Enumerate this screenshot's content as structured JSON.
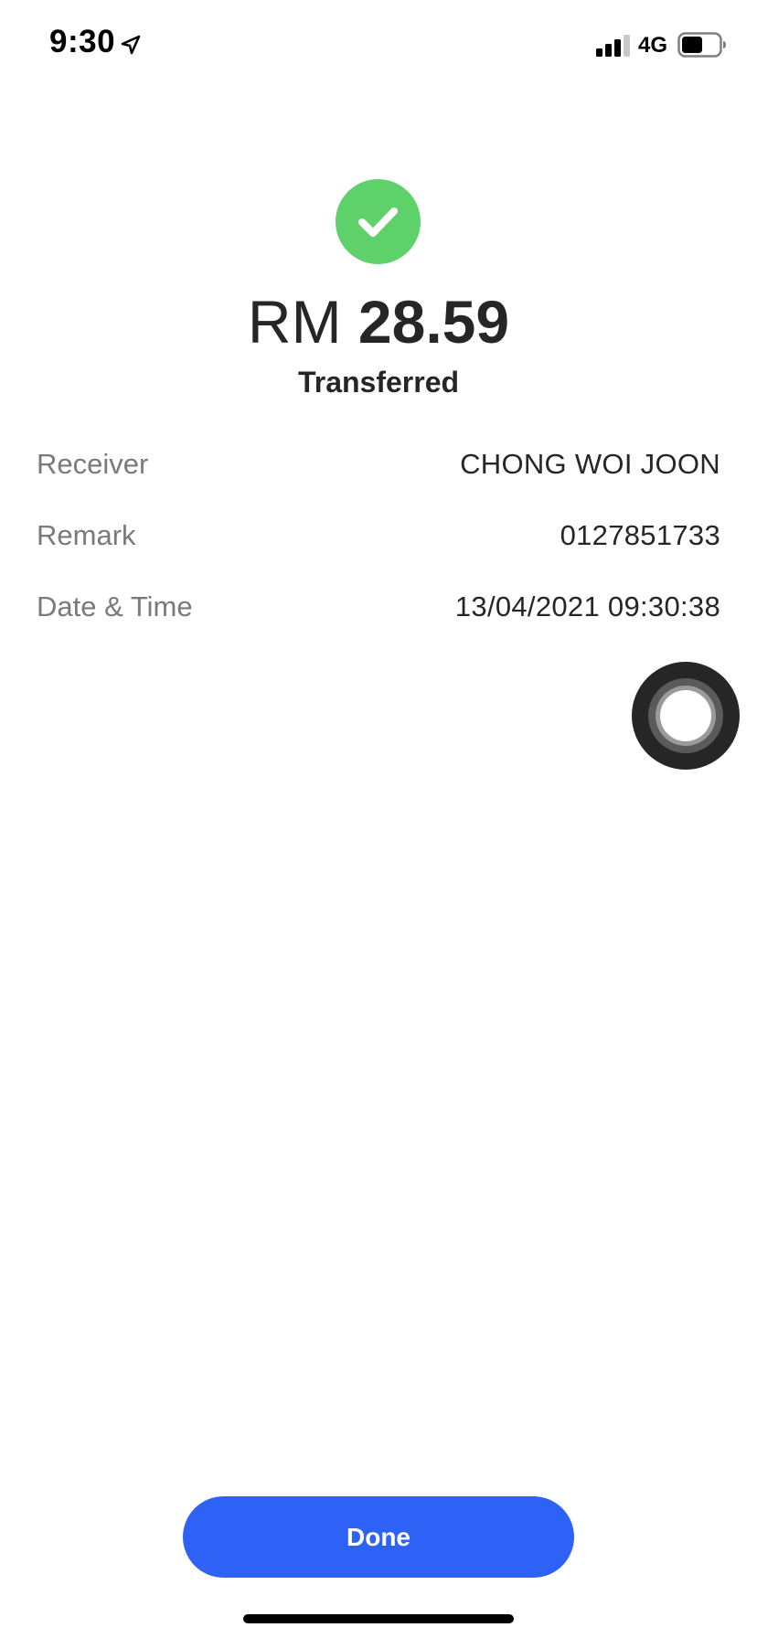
{
  "status_bar": {
    "time": "9:30",
    "network": "4G",
    "icons": [
      "location-arrow-icon",
      "signal-bars-icon",
      "battery-icon"
    ]
  },
  "receipt": {
    "success_icon": "checkmark-circle-icon",
    "success_color": "#5fd16b",
    "currency": "RM",
    "amount": "28.59",
    "status": "Transferred"
  },
  "details": {
    "receiver": {
      "label": "Receiver",
      "value": "CHONG WOI JOON"
    },
    "remark": {
      "label": "Remark",
      "value": "0127851733"
    },
    "datetime": {
      "label": "Date & Time",
      "value": "13/04/2021 09:30:38"
    }
  },
  "actions": {
    "done_label": "Done",
    "done_color": "#2e62f6"
  }
}
